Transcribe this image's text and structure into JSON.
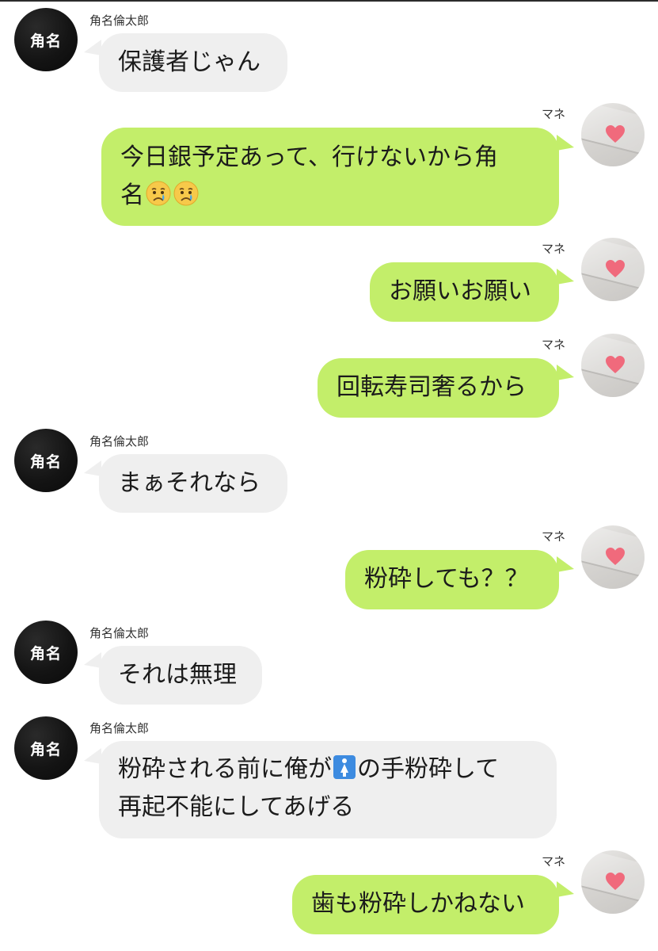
{
  "contacts": {
    "left_name": "角名倫太郎",
    "left_avatar_text": "角名",
    "right_name": "マネ"
  },
  "messages": [
    {
      "side": "left",
      "text": "保護者じゃん"
    },
    {
      "side": "right",
      "line1": "今日銀予定あって、行けないから角",
      "line2_prefix": "名",
      "emojis": [
        "crying-face",
        "crying-face"
      ]
    },
    {
      "side": "right",
      "text": "お願いお願い"
    },
    {
      "side": "right",
      "text": "回転寿司奢るから"
    },
    {
      "side": "left",
      "text": "まぁそれなら"
    },
    {
      "side": "right",
      "text": "粉砕しても？？"
    },
    {
      "side": "left",
      "text": "それは無理"
    },
    {
      "side": "left",
      "line1_pre": "粉砕される前に俺が",
      "line1_emoji": "womens-room-icon",
      "line1_post": "の手粉砕して",
      "line2": "再起不能にしてあげる"
    },
    {
      "side": "right",
      "text": "歯も粉砕しかねない"
    }
  ],
  "colors": {
    "left_bubble": "#efefef",
    "right_bubble": "#c3ee6a",
    "left_avatar": "#111111"
  }
}
